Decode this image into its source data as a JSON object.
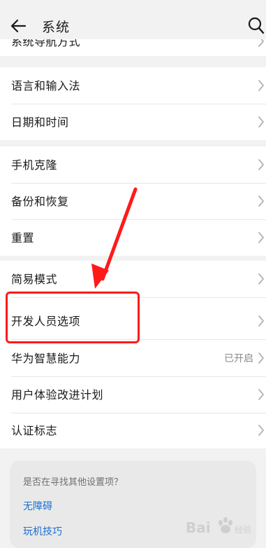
{
  "header": {
    "title": "系统"
  },
  "peek_item": {
    "label": "系统导航方式"
  },
  "groups": [
    {
      "items": [
        {
          "label": "语言和输入法"
        },
        {
          "label": "日期和时间"
        }
      ]
    },
    {
      "items": [
        {
          "label": "手机克隆"
        },
        {
          "label": "备份和恢复"
        },
        {
          "label": "重置"
        }
      ]
    },
    {
      "items": [
        {
          "label": "简易模式"
        },
        {
          "label": "开发人员选项"
        },
        {
          "label": "华为智慧能力",
          "value": "已开启"
        },
        {
          "label": "用户体验改进计划"
        },
        {
          "label": "认证标志"
        }
      ]
    }
  ],
  "suggestions": {
    "title": "是否在寻找其他设置项？",
    "links": [
      "无障碍",
      "玩机技巧"
    ]
  },
  "annotation": {
    "color": "#ff1a1a"
  },
  "colors": {
    "accent": "#1a6fd0",
    "background": "#f2f2f2",
    "card": "#ffffff"
  },
  "watermark": {
    "text": "Bai百度经验"
  }
}
